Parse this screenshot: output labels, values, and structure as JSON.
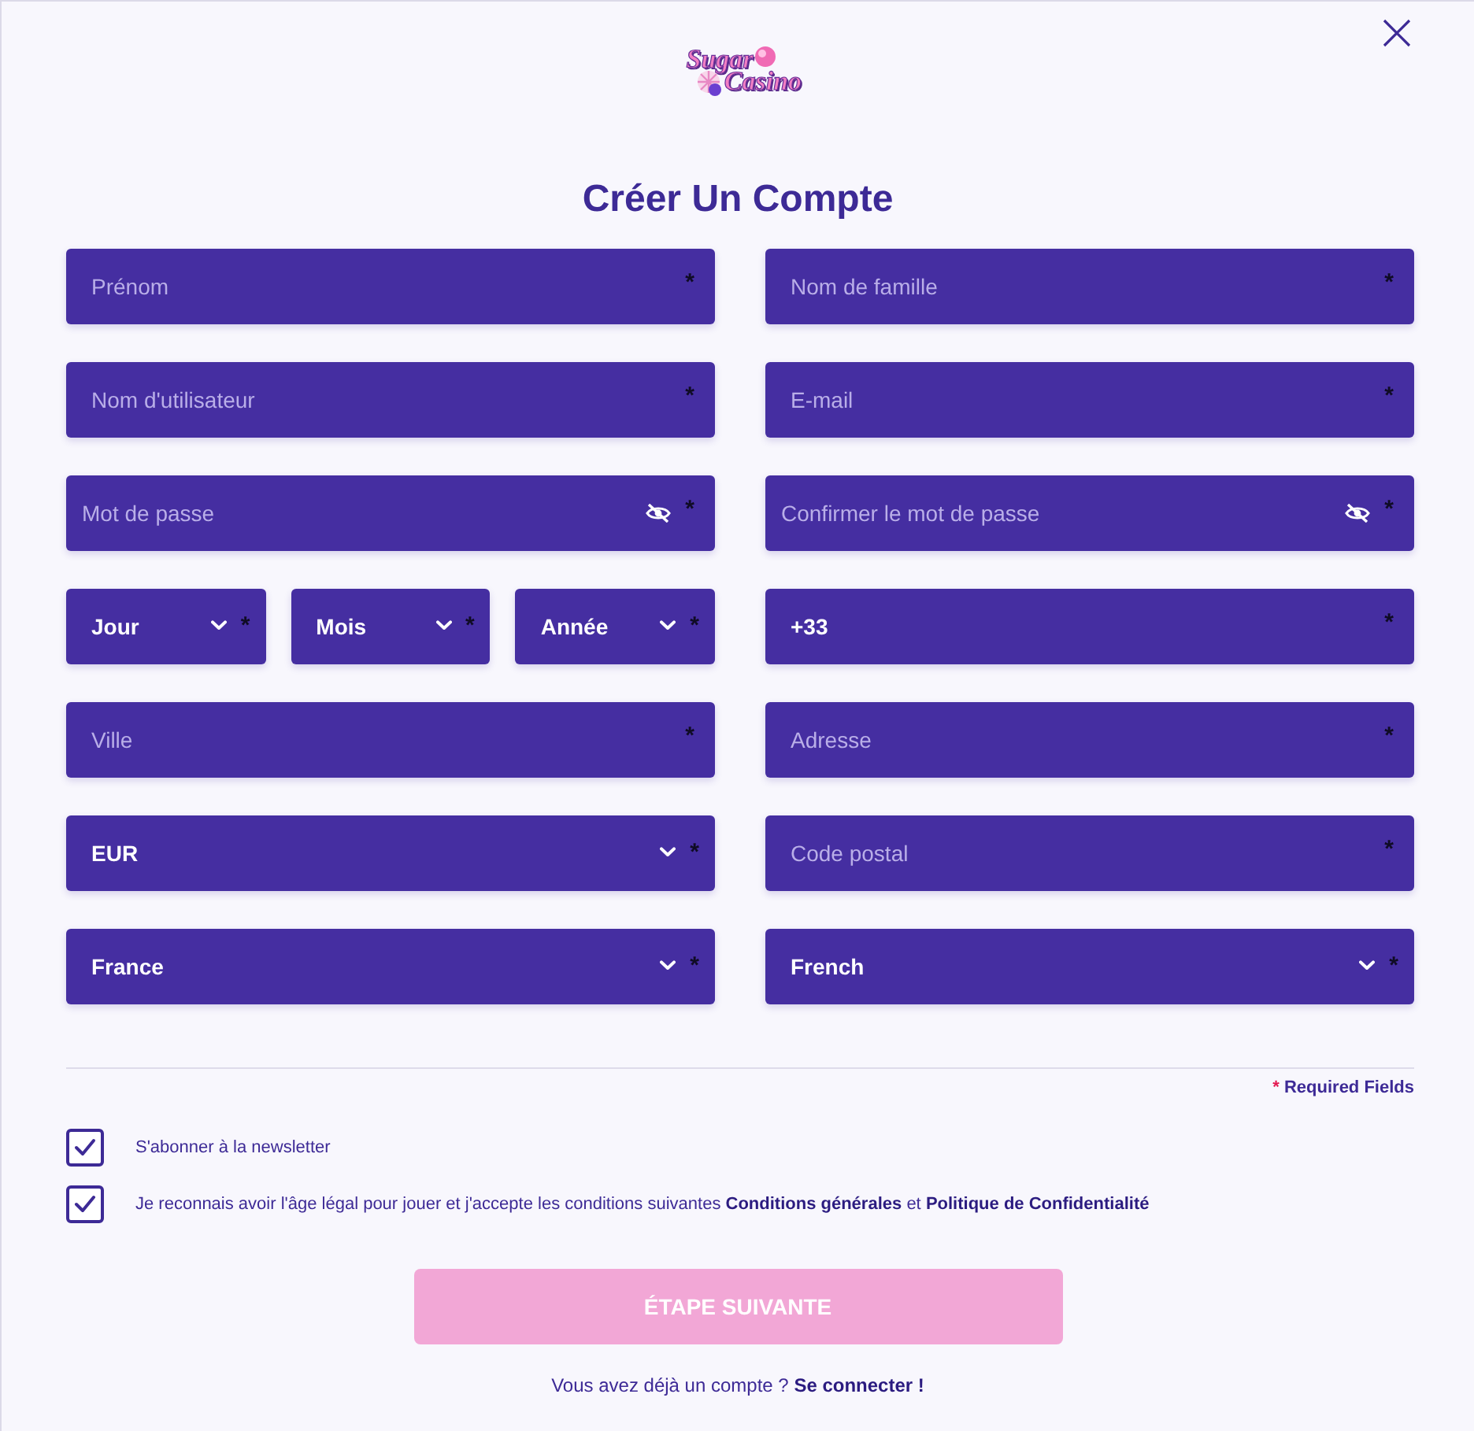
{
  "logo": {
    "line_1": "Sugar",
    "line_2": "Casino"
  },
  "title": "Créer Un Compte",
  "rows": [
    {
      "left": [
        {
          "kind": "text",
          "placeholder": "Prénom",
          "required_mark": "*"
        }
      ],
      "right": [
        {
          "kind": "text",
          "placeholder": "Nom de famille",
          "required_mark": "*"
        }
      ]
    },
    {
      "left": [
        {
          "kind": "text",
          "placeholder": "Nom d'utilisateur",
          "required_mark": "*"
        }
      ],
      "right": [
        {
          "kind": "text",
          "placeholder": "E-mail",
          "required_mark": "*"
        }
      ]
    },
    {
      "left": [
        {
          "kind": "password",
          "placeholder": "Mot de passe",
          "required_mark": "*"
        }
      ],
      "right": [
        {
          "kind": "password",
          "placeholder": "Confirmer le mot de passe",
          "required_mark": "*"
        }
      ]
    },
    {
      "left": [
        {
          "kind": "select",
          "value": "Jour",
          "required_mark": "*"
        },
        {
          "kind": "select",
          "value": "Mois",
          "required_mark": "*"
        },
        {
          "kind": "select",
          "value": "Année",
          "required_mark": "*"
        }
      ],
      "right": [
        {
          "kind": "text",
          "value": "+33",
          "required_mark": "*"
        }
      ]
    },
    {
      "left": [
        {
          "kind": "text",
          "placeholder": "Ville",
          "required_mark": "*"
        }
      ],
      "right": [
        {
          "kind": "text",
          "placeholder": "Adresse",
          "required_mark": "*"
        }
      ]
    },
    {
      "left": [
        {
          "kind": "select",
          "value": "EUR",
          "required_mark": "*"
        }
      ],
      "right": [
        {
          "kind": "text",
          "placeholder": "Code postal",
          "required_mark": "*"
        }
      ]
    },
    {
      "left": [
        {
          "kind": "select",
          "value": "France",
          "required_mark": "*"
        }
      ],
      "right": [
        {
          "kind": "select",
          "value": "French",
          "required_mark": "*"
        }
      ]
    }
  ],
  "required_note": {
    "mark": "*",
    "text": "Required Fields"
  },
  "checkboxes": [
    {
      "checked": true,
      "label": [
        {
          "kind": "text",
          "text": "S'abonner à la newsletter"
        }
      ]
    },
    {
      "checked": true,
      "label": [
        {
          "kind": "text",
          "text": "Je reconnais avoir l'âge légal pour jouer et j'accepte les conditions suivantes"
        },
        {
          "kind": "link",
          "text": "Conditions générales"
        },
        {
          "kind": "text",
          "text": "et"
        },
        {
          "kind": "link",
          "text": "Politique de Confidentialité"
        }
      ]
    }
  ],
  "submit_button": {
    "label": "ÉTAPE SUIVANTE",
    "disabled": true
  },
  "footer": [
    {
      "kind": "text",
      "text": "Vous avez déjà un compte ?"
    },
    {
      "kind": "link",
      "text": "Se connecter !"
    }
  ]
}
